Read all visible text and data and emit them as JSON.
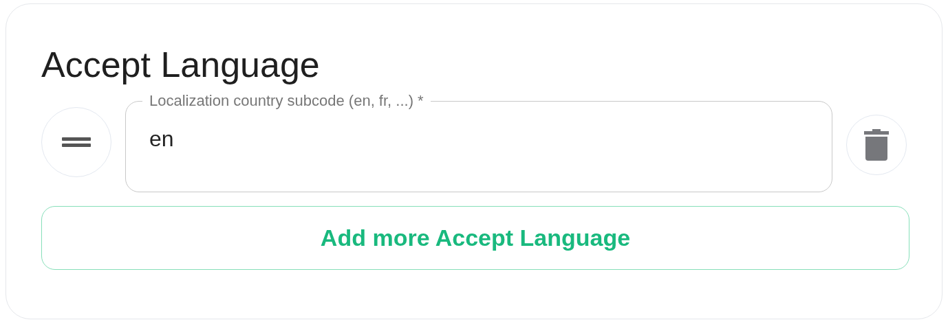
{
  "title": "Accept Language",
  "entries": [
    {
      "label": "Localization country subcode (en, fr, ...) *",
      "value": "en"
    }
  ],
  "add_button": "Add more Accept Language"
}
